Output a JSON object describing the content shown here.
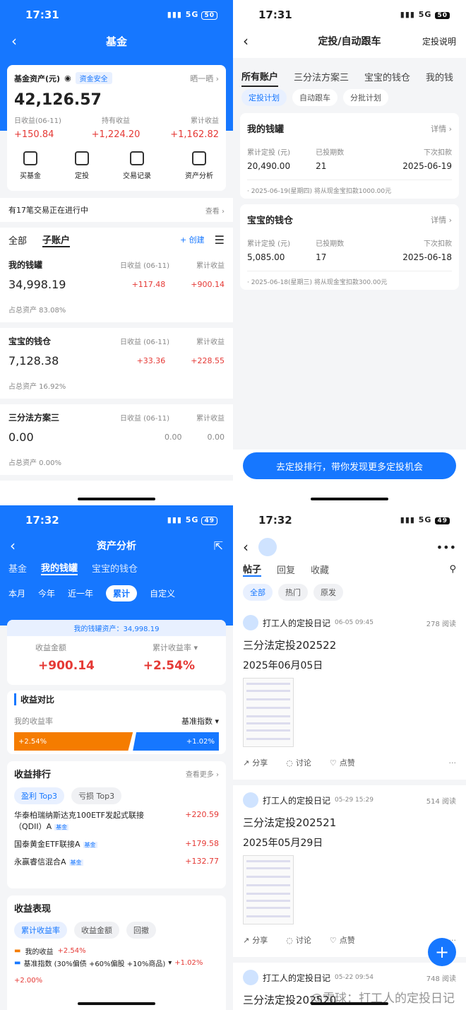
{
  "p1": {
    "time": "17:31",
    "net": "5G",
    "battery": "50",
    "title": "基金",
    "asset_label": "基金资产(元)",
    "safe": "资金安全",
    "share": "晒一晒",
    "total": "42,126.57",
    "stats": [
      {
        "label": "日收益(06-11)",
        "value": "+150.84"
      },
      {
        "label": "持有收益",
        "value": "+1,224.20"
      },
      {
        "label": "累计收益",
        "value": "+1,162.82"
      }
    ],
    "actions": [
      "买基金",
      "定投",
      "交易记录",
      "资产分析"
    ],
    "notice": "有17笔交易正在进行中",
    "notice_link": "查看",
    "tabs": [
      "全部",
      "子账户"
    ],
    "create": "+ 创建",
    "accounts": [
      {
        "name": "我的钱罐",
        "day_label": "日收益 (06-11)",
        "cum_label": "累计收益",
        "value": "34,998.19",
        "day": "+117.48",
        "cum": "+900.14",
        "share": "占总资产  83.08%"
      },
      {
        "name": "宝宝的钱仓",
        "day_label": "日收益 (06-11)",
        "cum_label": "累计收益",
        "value": "7,128.38",
        "day": "+33.36",
        "cum": "+228.55",
        "share": "占总资产  16.92%"
      },
      {
        "name": "三分法方案三",
        "day_label": "日收益 (06-11)",
        "cum_label": "累计收益",
        "value": "0.00",
        "day": "0.00",
        "cum": "0.00",
        "share": "占总资产  0.00%"
      }
    ]
  },
  "p2": {
    "time": "17:31",
    "net": "5G",
    "battery": "50",
    "title": "定投/自动跟车",
    "help": "定投说明",
    "tabs": [
      "所有账户",
      "三分法方案三",
      "宝宝的钱仓",
      "我的钱"
    ],
    "subtabs": [
      "定投计划",
      "自动跟车",
      "分批计划"
    ],
    "plans": [
      {
        "name": "我的钱罐",
        "detail": "详情",
        "l1": "累计定投 (元)",
        "l2": "已投期数",
        "l3": "下次扣款",
        "v1": "20,490.00",
        "v2": "21",
        "v3": "2025-06-19",
        "note": "· 2025-06-19(星期四) 将从现金宝扣款1000.00元"
      },
      {
        "name": "宝宝的钱仓",
        "detail": "详情",
        "l1": "累计定投 (元)",
        "l2": "已投期数",
        "l3": "下次扣款",
        "v1": "5,085.00",
        "v2": "17",
        "v3": "2025-06-18",
        "note": "· 2025-06-18(星期三) 将从现金宝扣款300.00元"
      }
    ],
    "cta": "去定投排行，带你发现更多定投机会"
  },
  "p3": {
    "time": "17:32",
    "net": "5G",
    "battery": "49",
    "title": "资产分析",
    "tabs": [
      "基金",
      "我的钱罐",
      "宝宝的钱仓"
    ],
    "periods": [
      "本月",
      "今年",
      "近一年",
      "累计",
      "自定义"
    ],
    "banner": "我的钱罐资产：34,998.19",
    "inc_label": "收益金额",
    "rate_label": "累计收益率",
    "inc": "+900.14",
    "rate": "+2.54%",
    "cmp_title": "收益对比",
    "my_rate": "我的收益率",
    "bench": "基准指数",
    "bar_left": "+2.54%",
    "bar_right": "+1.02%",
    "rank_title": "收益排行",
    "more": "查看更多",
    "rank_tabs": [
      "盈利 Top3",
      "亏损 Top3"
    ],
    "funds": [
      {
        "name": "华泰柏瑞纳斯达克100ETF发起式联接（QDII）A",
        "tag": "基金",
        "val": "+220.59"
      },
      {
        "name": "国泰黄金ETF联接A",
        "tag": "基金",
        "val": "+179.58"
      },
      {
        "name": "永赢睿信混合A",
        "tag": "基金",
        "val": "+132.77"
      }
    ],
    "perf_title": "收益表现",
    "perf_tabs": [
      "累计收益率",
      "收益金额",
      "回撤"
    ],
    "legend1": "我的收益",
    "legend1_val": "+2.54%",
    "legend2": "基准指数 (30%偏债 +60%偏股 +10%商品)",
    "legend2_val": "+1.02%",
    "ytick": "+2.00%"
  },
  "p4": {
    "time": "17:32",
    "net": "5G",
    "battery": "49",
    "tabs": [
      "帖子",
      "回复",
      "收藏"
    ],
    "filters": [
      "全部",
      "热门",
      "原发"
    ],
    "posts": [
      {
        "author": "打工人的定投日记",
        "date": "06-05 09:45",
        "reads": "278 阅读",
        "title": "三分法定投202522",
        "sub": "2025年06月05日"
      },
      {
        "author": "打工人的定投日记",
        "date": "05-29 15:29",
        "reads": "514 阅读",
        "title": "三分法定投202521",
        "sub": "2025年05月29日"
      },
      {
        "author": "打工人的定投日记",
        "date": "05-22 09:54",
        "reads": "748 阅读",
        "title": "三分法定投202520",
        "sub": ""
      }
    ],
    "acts": [
      "分享",
      "讨论",
      "点赞"
    ],
    "watermark": "@雪球：打工人的定投日记"
  },
  "colors": {
    "blue": "#1677ff",
    "red": "#e53935",
    "orange": "#f57c00"
  }
}
